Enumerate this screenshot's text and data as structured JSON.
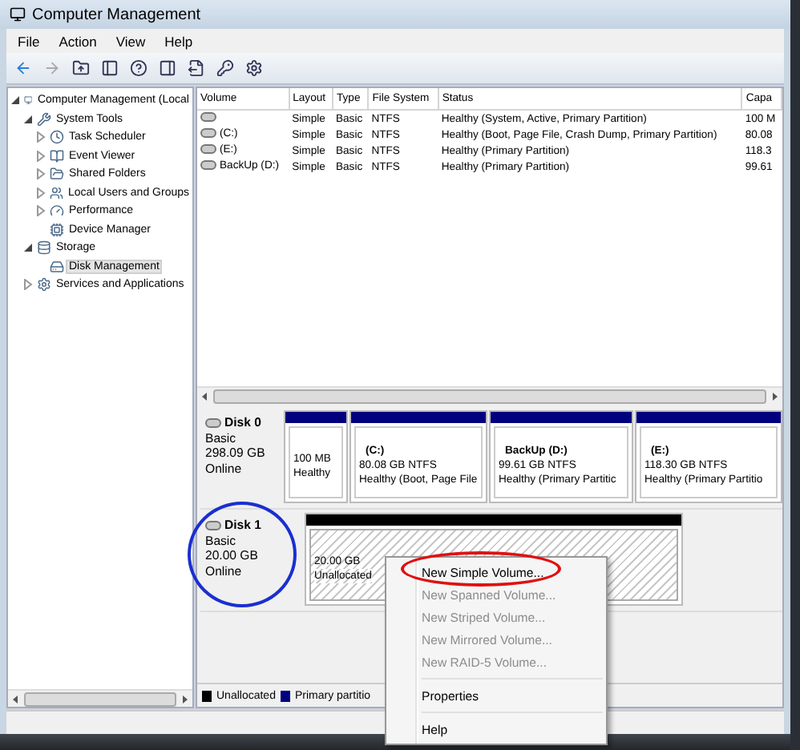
{
  "window": {
    "title": "Computer Management"
  },
  "menu_bar": [
    "File",
    "Action",
    "View",
    "Help"
  ],
  "tree": [
    {
      "label": "Computer Management (Local",
      "expanded": true,
      "selected": false,
      "children": [
        {
          "label": "System Tools",
          "expanded": true,
          "selected": false,
          "children": [
            {
              "label": "Task Scheduler",
              "expanded": false,
              "selected": false
            },
            {
              "label": "Event Viewer",
              "expanded": false,
              "selected": false
            },
            {
              "label": "Shared Folders",
              "expanded": false,
              "selected": false
            },
            {
              "label": "Local Users and Groups",
              "expanded": false,
              "selected": false
            },
            {
              "label": "Performance",
              "expanded": false,
              "selected": false
            },
            {
              "label": "Device Manager",
              "selected": false
            }
          ]
        },
        {
          "label": "Storage",
          "expanded": true,
          "selected": false,
          "children": [
            {
              "label": "Disk Management",
              "selected": true
            }
          ]
        },
        {
          "label": "Services and Applications",
          "expanded": false,
          "selected": false
        }
      ]
    }
  ],
  "volume_table": {
    "columns": [
      "Volume",
      "Layout",
      "Type",
      "File System",
      "Status",
      "Capa"
    ],
    "rows": [
      [
        "",
        "Simple",
        "Basic",
        "NTFS",
        "Healthy (System, Active, Primary Partition)",
        "100 M"
      ],
      [
        "(C:)",
        "Simple",
        "Basic",
        "NTFS",
        "Healthy (Boot, Page File, Crash Dump, Primary Partition)",
        "80.08"
      ],
      [
        "(E:)",
        "Simple",
        "Basic",
        "NTFS",
        "Healthy (Primary Partition)",
        "118.3"
      ],
      [
        "BackUp (D:)",
        "Simple",
        "Basic",
        "NTFS",
        "Healthy (Primary Partition)",
        "99.61"
      ]
    ]
  },
  "disks": [
    {
      "name": "Disk 0",
      "type": "Basic",
      "size": "298.09 GB",
      "status": "Online",
      "partitions": [
        {
          "kind": "primary",
          "size": "100 MB",
          "health": "Healthy"
        },
        {
          "kind": "primary",
          "name": "(C:)",
          "size": "80.08 GB NTFS",
          "health": "Healthy (Boot, Page File"
        },
        {
          "kind": "primary",
          "name": "BackUp  (D:)",
          "size": "99.61 GB NTFS",
          "health": "Healthy (Primary Partitic"
        },
        {
          "kind": "primary",
          "name": "(E:)",
          "size": "118.30 GB NTFS",
          "health": "Healthy (Primary Partitio"
        }
      ]
    },
    {
      "name": "Disk 1",
      "type": "Basic",
      "size": "20.00 GB",
      "status": "Online",
      "partitions": [
        {
          "kind": "unallocated",
          "size": "20.00 GB",
          "health": "Unallocated"
        }
      ]
    }
  ],
  "legend": [
    {
      "label": "Unallocated",
      "color": "#000000"
    },
    {
      "label": "Primary partitio",
      "color": "#00007f"
    }
  ],
  "context_menu": [
    {
      "kind": "item",
      "label": "New Simple Volume...",
      "disabled": false
    },
    {
      "kind": "item",
      "label": "New Spanned Volume...",
      "disabled": true
    },
    {
      "kind": "item",
      "label": "New Striped Volume...",
      "disabled": true
    },
    {
      "kind": "item",
      "label": "New Mirrored Volume...",
      "disabled": true
    },
    {
      "kind": "item",
      "label": "New RAID-5 Volume...",
      "disabled": true
    },
    {
      "kind": "separator"
    },
    {
      "kind": "item",
      "label": "Properties",
      "disabled": false
    },
    {
      "kind": "separator"
    },
    {
      "kind": "item",
      "label": "Help",
      "disabled": false
    }
  ]
}
